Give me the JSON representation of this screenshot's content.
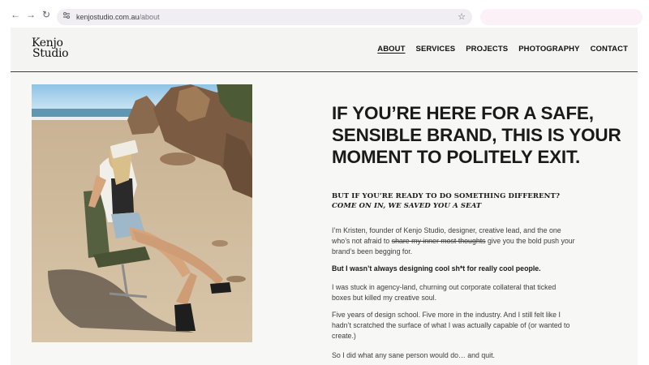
{
  "browser": {
    "url_host": "kenjostudio.com.au",
    "url_path": "/about",
    "back_icon": "←",
    "forward_icon": "→",
    "reload_icon": "↻",
    "star_icon": "☆"
  },
  "site": {
    "logo_line1": "Kenjo",
    "logo_line2": "Studio"
  },
  "nav": {
    "about": "ABOUT",
    "services": "SERVICES",
    "projects": "PROJECTS",
    "photography": "PHOTOGRAPHY",
    "contact": "CONTACT"
  },
  "hero": {
    "heading": "IF YOU’RE HERE FOR A SAFE, SENSIBLE BRAND, THIS IS YOUR MOMENT TO POLITELY EXIT.",
    "sub_line1": "BUT IF YOU’RE READY TO DO SOMETHING DIFFERENT?",
    "sub_line2": "COME ON IN, WE SAVED YOU A SEAT"
  },
  "body": {
    "p1_start": "I’m Kristen, founder of Kenjo Studio, designer, creative lead, and the one who’s not afraid to ",
    "p1_strike": "share my inner most thoughts",
    "p1_end": " give you the bold push your brand’s been begging for.",
    "p2": "But I wasn’t always designing cool sh*t for really cool people.",
    "p3": "I was stuck in agency-land, churning out corporate collateral that ticked boxes but killed my creative soul.",
    "p4": "Five years of design school. Five more in the industry. And I still felt like I hadn’t scratched the surface of what I was actually capable of (or wanted to create.)",
    "p5": "So I did what any sane person would do… and quit."
  }
}
